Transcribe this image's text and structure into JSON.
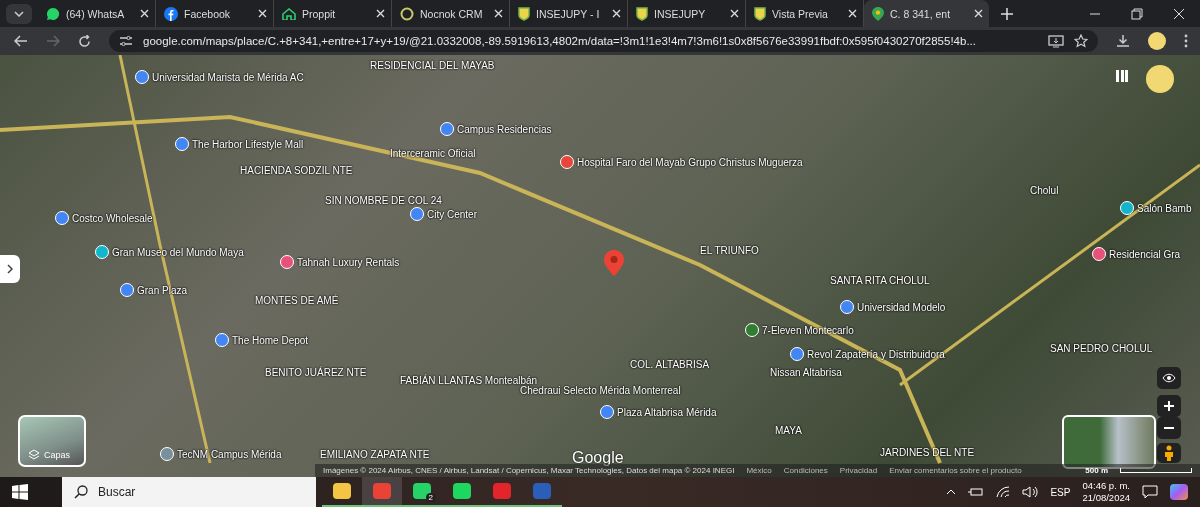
{
  "tabs": [
    {
      "title": "(64) WhatsA",
      "selected": false
    },
    {
      "title": "Facebook",
      "selected": false
    },
    {
      "title": "Proppit",
      "selected": false
    },
    {
      "title": "Nocnok CRM",
      "selected": false
    },
    {
      "title": "INSEJUPY - I",
      "selected": false
    },
    {
      "title": "INSEJUPY",
      "selected": false
    },
    {
      "title": "Vista Previa",
      "selected": false
    },
    {
      "title": "C. 8 341, ent",
      "selected": true
    }
  ],
  "address": "google.com/maps/place/C.+8+341,+entre+17+y+19/@21.0332008,-89.5919613,4802m/data=!3m1!1e3!4m7!3m6!1s0x8f5676e33991fbdf:0x595f0430270f2855!4b...",
  "map": {
    "places": [
      {
        "name": "RESIDENCIAL DEL MAYAB"
      },
      {
        "name": "Universidad Marista de Mérida AC",
        "color": "#4285f4"
      },
      {
        "name": "Campus Residencias",
        "color": "#4285f4"
      },
      {
        "name": "The Harbor Lifestyle Mall",
        "color": "#4285f4"
      },
      {
        "name": "Interceramic Oficial"
      },
      {
        "name": "Hospital Faro del Mayab Grupo Christus Muguerza",
        "color": "#e8453c"
      },
      {
        "name": "HACIENDA SODZIL NTE"
      },
      {
        "name": "Cholul"
      },
      {
        "name": "SIN NOMBRE DE COL 24"
      },
      {
        "name": "City Center",
        "color": "#4285f4"
      },
      {
        "name": "Salón Bamb",
        "color": "#12b5cb"
      },
      {
        "name": "Costco Wholesale",
        "color": "#4285f4"
      },
      {
        "name": "Gran Museo del Mundo Maya",
        "color": "#12b5cb"
      },
      {
        "name": "EL TRIUNFO"
      },
      {
        "name": "Residencial Gra",
        "color": "#e8527a"
      },
      {
        "name": "Tahnah Luxury Rentals",
        "color": "#e8527a"
      },
      {
        "name": "SANTA RITA CHOLUL"
      },
      {
        "name": "Gran Plaza",
        "color": "#4285f4"
      },
      {
        "name": "MONTES DE AMÉ"
      },
      {
        "name": "Universidad Modelo",
        "color": "#4285f4"
      },
      {
        "name": "7-Eleven Montecarlo",
        "color": "#2e7d32"
      },
      {
        "name": "The Home Depot",
        "color": "#4285f4"
      },
      {
        "name": "SAN PEDRO CHOLUL"
      },
      {
        "name": "Revol Zapatería y Distribuidora",
        "color": "#4285f4"
      },
      {
        "name": "BENITO JUÁREZ NTE"
      },
      {
        "name": "COL. ALTABRISA"
      },
      {
        "name": "Nissan Altabrisa"
      },
      {
        "name": "FABIÁN LLANTAS Montealbán"
      },
      {
        "name": "Chedraui Selecto Mérida Monterreal"
      },
      {
        "name": "Plaza Altabrisa Mérida",
        "color": "#4285f4"
      },
      {
        "name": "MAYA"
      },
      {
        "name": "TecNM Campus Mérida",
        "color": "#78909c"
      },
      {
        "name": "EMILIANO ZAPATA NTE"
      },
      {
        "name": "JARDINES DEL NTE"
      }
    ],
    "layers_label": "Capas",
    "logo": "Google",
    "attribution": "Imágenes © 2024 Airbus, CNES / Airbus, Landsat / Copernicus, Maxar Technologies, Datos del mapa © 2024 INEGI",
    "footer_links": [
      "México",
      "Condiciones",
      "Privacidad",
      "Enviar comentarios sobre el producto"
    ],
    "scale": "500 m"
  },
  "taskbar": {
    "search_placeholder": "Buscar",
    "apps": [
      {
        "selected": false
      },
      {
        "selected": true
      },
      {
        "selected": false,
        "badge": "2"
      },
      {
        "selected": false
      },
      {
        "selected": false
      },
      {
        "selected": false
      }
    ],
    "language": "ESP",
    "time": "04:46 p. m.",
    "date": "21/08/2024"
  }
}
